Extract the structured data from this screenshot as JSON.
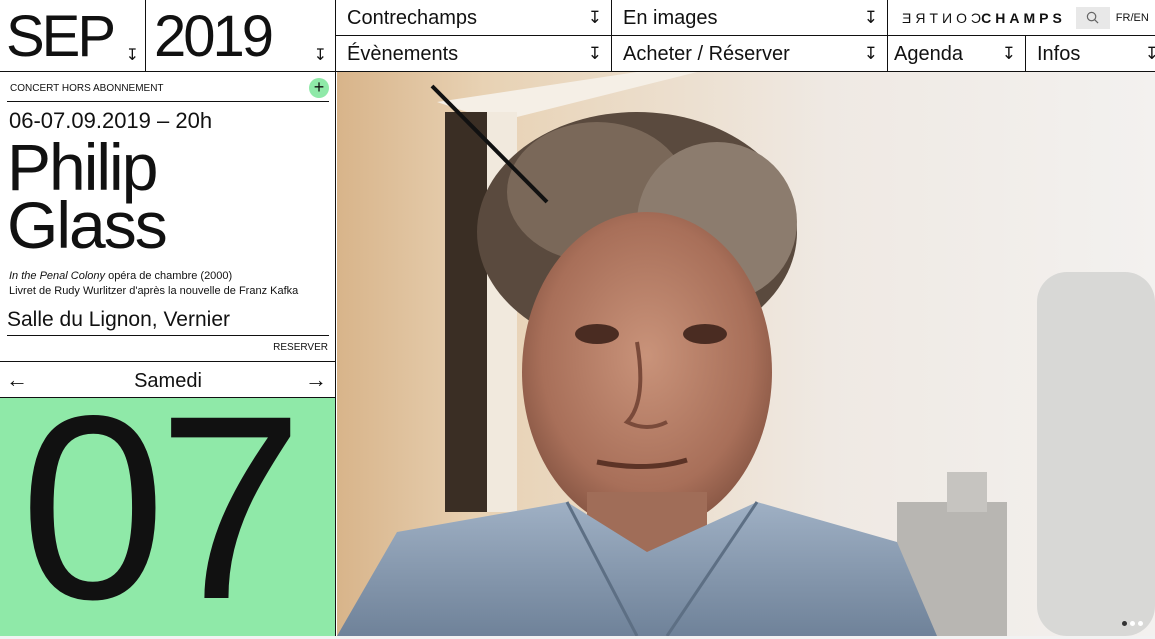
{
  "header": {
    "month": "SEP",
    "year": "2019",
    "arrow": "↧"
  },
  "nav": {
    "items": [
      {
        "label": "Contrechamps"
      },
      {
        "label": "En images"
      },
      {
        "label": "Évènements"
      },
      {
        "label": "Acheter / Réserver"
      },
      {
        "label": "Agenda"
      },
      {
        "label": "Infos"
      }
    ],
    "logo_mirror": "CONTRE",
    "logo_bold": "CHAMPS",
    "lang": "FR/EN"
  },
  "event": {
    "tag": "CONCERT HORS ABONNEMENT",
    "plus": "+",
    "when": "06-07.09.2019 – 20h",
    "title_line1": "Philip",
    "title_line2": "Glass",
    "work_title": "In the Penal Colony",
    "work_desc": " opéra de chambre (2000)",
    "libretto": "Livret de Rudy Wurlitzer d'après la nouvelle de Franz Kafka",
    "venue": "Salle du Lignon, Vernier",
    "reserve": "RESERVER"
  },
  "day": {
    "prev": "←",
    "next": "→",
    "name": "Samedi",
    "number": "07"
  },
  "colors": {
    "accent": "#8fe9a8",
    "text": "#111111"
  },
  "carousel": {
    "slides": 3,
    "active_slide": 1
  }
}
